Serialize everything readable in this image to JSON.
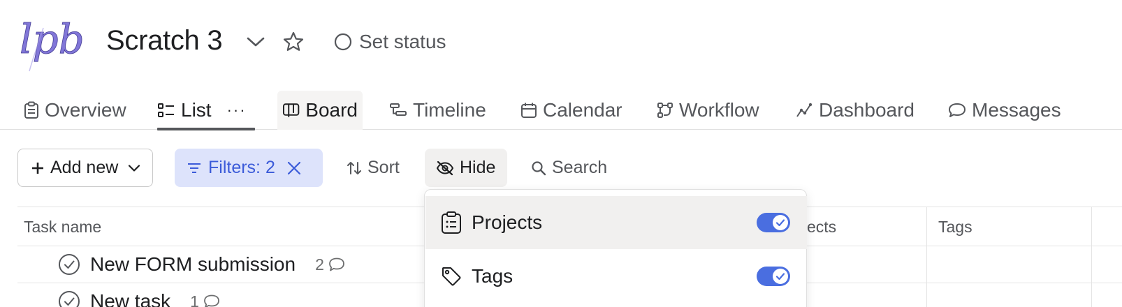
{
  "header": {
    "logo_text": "lpb",
    "project_title": "Scratch 3",
    "set_status_label": "Set status"
  },
  "tabs": [
    {
      "label": "Overview",
      "icon": "clipboard-icon"
    },
    {
      "label": "List",
      "icon": "list-icon",
      "active": true
    },
    {
      "label": "Board",
      "icon": "board-icon"
    },
    {
      "label": "Timeline",
      "icon": "timeline-icon"
    },
    {
      "label": "Calendar",
      "icon": "calendar-icon"
    },
    {
      "label": "Workflow",
      "icon": "workflow-icon"
    },
    {
      "label": "Dashboard",
      "icon": "dashboard-icon"
    },
    {
      "label": "Messages",
      "icon": "message-icon"
    }
  ],
  "tab_more": "···",
  "toolbar": {
    "add_new_label": "Add new",
    "filters_label": "Filters: 2",
    "sort_label": "Sort",
    "hide_label": "Hide",
    "search_label": "Search"
  },
  "table": {
    "columns": [
      "Task name",
      "ects",
      "Tags"
    ],
    "rows": [
      {
        "name": "New FORM submission",
        "comment_count": "2"
      },
      {
        "name": "New task",
        "comment_count": "1"
      }
    ]
  },
  "hide_menu": {
    "items": [
      {
        "label": "Projects",
        "icon": "clipboard-icon",
        "enabled": true
      },
      {
        "label": "Tags",
        "icon": "tag-icon",
        "enabled": true
      }
    ]
  },
  "colors": {
    "accent_blue": "#4a6ee0",
    "filter_bg": "#dde3fb",
    "filter_text": "#3b5bd9",
    "logo_purple": "#7b6fd6"
  }
}
